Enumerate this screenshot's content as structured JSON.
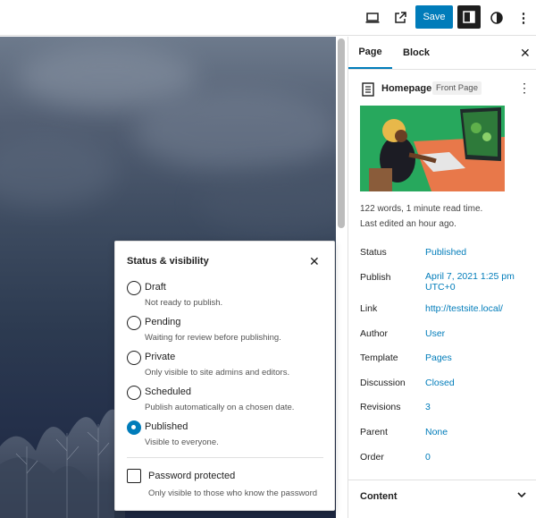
{
  "toolbar": {
    "save_label": "Save",
    "more_icon": "⋮"
  },
  "popover": {
    "title": "Status & visibility",
    "close": "✕",
    "options": [
      {
        "label": "Draft",
        "desc": "Not ready to publish.",
        "checked": false
      },
      {
        "label": "Pending",
        "desc": "Waiting for review before publishing.",
        "checked": false
      },
      {
        "label": "Private",
        "desc": "Only visible to site admins and editors.",
        "checked": false
      },
      {
        "label": "Scheduled",
        "desc": "Publish automatically on a chosen date.",
        "checked": false
      },
      {
        "label": "Published",
        "desc": "Visible to everyone.",
        "checked": true
      }
    ],
    "password": {
      "label": "Password protected",
      "desc": "Only visible to those who know the password"
    }
  },
  "sidebar": {
    "tabs": [
      "Page",
      "Block"
    ],
    "close": "✕",
    "doc_title": "Homepage",
    "badge": "Front Page",
    "kebab": "⋮",
    "meta": [
      "122 words, 1 minute read time.",
      "Last edited an hour ago."
    ],
    "rows": [
      {
        "label": "Status",
        "value": "Published"
      },
      {
        "label": "Publish",
        "value": "April 7, 2021 1:25 pm",
        "value2": "UTC+0"
      },
      {
        "label": "Link",
        "value": "http://testsite.local/"
      },
      {
        "label": "Author",
        "value": "User"
      },
      {
        "label": "Template",
        "value": "Pages"
      },
      {
        "label": "Discussion",
        "value": "Closed"
      },
      {
        "label": "Revisions",
        "value": "3"
      },
      {
        "label": "Parent",
        "value": "None"
      },
      {
        "label": "Order",
        "value": "0"
      }
    ],
    "content_label": "Content"
  },
  "colors": {
    "accent": "#007cba",
    "dark": "#1e1e1e"
  }
}
